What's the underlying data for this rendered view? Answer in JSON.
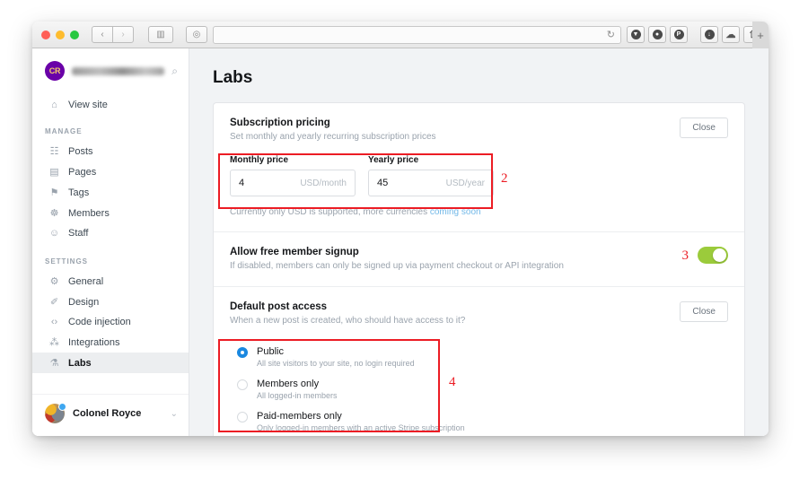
{
  "browser": {
    "url_value": "",
    "reload_icon": "reload-icon",
    "back_icon": "‹",
    "forward_icon": "›",
    "sidebar_icon": "▥",
    "shield_icon": "◎",
    "extensions": [
      "pocket-icon",
      "evernote-icon",
      "pinterest-icon"
    ],
    "right_icons": [
      "download-icon",
      "cloud-icon",
      "share-icon"
    ],
    "new_tab_label": "+"
  },
  "sidebar": {
    "site_avatar_initials": "CR",
    "site_name": "",
    "search_icon": "⌕",
    "view_site": {
      "label": "View site",
      "icon": "⌂"
    },
    "sections": [
      {
        "label": "MANAGE",
        "items": [
          {
            "label": "Posts",
            "icon": "☷",
            "active": false
          },
          {
            "label": "Pages",
            "icon": "▤",
            "active": false
          },
          {
            "label": "Tags",
            "icon": "⚑",
            "active": false
          },
          {
            "label": "Members",
            "icon": "☸",
            "active": false
          },
          {
            "label": "Staff",
            "icon": "☺",
            "active": false
          }
        ]
      },
      {
        "label": "SETTINGS",
        "items": [
          {
            "label": "General",
            "icon": "⚙",
            "active": false
          },
          {
            "label": "Design",
            "icon": "✐",
            "active": false
          },
          {
            "label": "Code injection",
            "icon": "‹›",
            "active": false
          },
          {
            "label": "Integrations",
            "icon": "⁂",
            "active": false
          },
          {
            "label": "Labs",
            "icon": "⚗",
            "active": true
          }
        ]
      }
    ],
    "user": {
      "name": "Colonel Royce",
      "chevron": "⌄"
    }
  },
  "main": {
    "page_title": "Labs",
    "subscription": {
      "title": "Subscription pricing",
      "description": "Set monthly and yearly recurring subscription prices",
      "close_label": "Close",
      "monthly": {
        "label": "Monthly price",
        "value": "4",
        "suffix": "USD/month"
      },
      "yearly": {
        "label": "Yearly price",
        "value": "45",
        "suffix": "USD/year"
      },
      "note_text": "Currently only USD is supported, more currencies ",
      "note_link": "coming soon"
    },
    "free_signup": {
      "title": "Allow free member signup",
      "description": "If disabled, members can only be signed up via payment checkout or API integration",
      "toggle_on": true
    },
    "post_access": {
      "title": "Default post access",
      "description": "When a new post is created, who should have access to it?",
      "close_label": "Close",
      "options": [
        {
          "title": "Public",
          "description": "All site visitors to your site, no login required",
          "selected": true
        },
        {
          "title": "Members only",
          "description": "All logged-in members",
          "selected": false
        },
        {
          "title": "Paid-members only",
          "description": "Only logged-in members with an active Stripe subscription",
          "selected": false
        }
      ]
    }
  },
  "annotations": [
    {
      "number": "2"
    },
    {
      "number": "3"
    },
    {
      "number": "4"
    }
  ],
  "colors": {
    "accent_blue": "#1a88e0",
    "toggle_green": "#9bcb3b",
    "annotation_red": "#ec1c24",
    "link_blue": "#73b9e8",
    "avatar_purple": "#6a01a8"
  }
}
